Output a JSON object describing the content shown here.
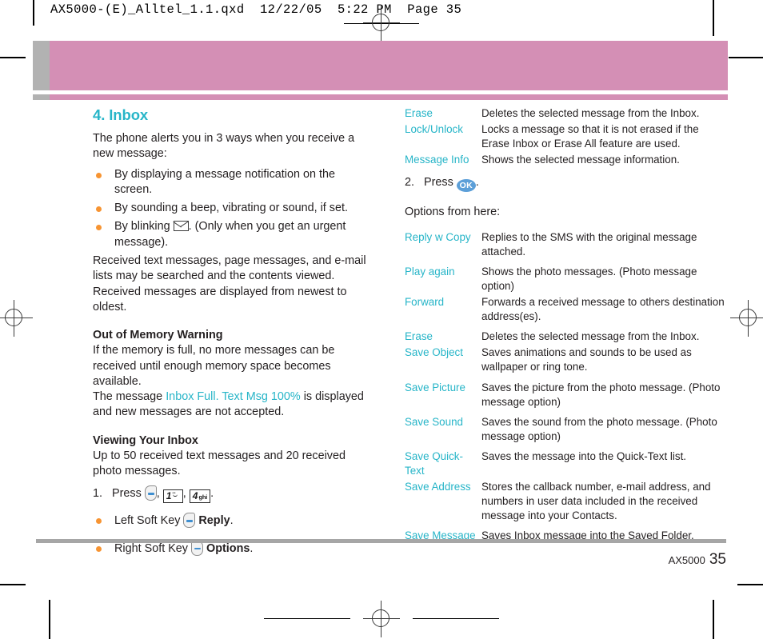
{
  "prepress": {
    "header_line": "AX5000-(E)_Alltel_1.1.qxd  12/22/05  5:22 PM  Page 35"
  },
  "colors": {
    "heading_teal": "#27b5c8",
    "bullet_orange": "#f79432",
    "banner_pink": "#d48fb5",
    "tab_gray": "#b2b2b2",
    "ok_blue": "#5c9fd8",
    "body_text": "#231f20"
  },
  "left_column": {
    "section_title": "4. Inbox",
    "intro": "The phone alerts you in 3 ways when you receive a new message:",
    "alert_bullets": [
      {
        "text_before": "By displaying a message notification on the screen.",
        "icon": null,
        "text_after": ""
      },
      {
        "text_before": "By sounding a beep, vibrating or sound, if set.",
        "icon": null,
        "text_after": ""
      },
      {
        "text_before": "By blinking ",
        "icon": "envelope-icon",
        "text_after": ". (Only when you get an urgent message)."
      }
    ],
    "received_paragraph": "Received text messages, page messages, and e-mail lists may be searched and the contents viewed. Received messages are displayed from newest to oldest.",
    "out_of_memory": {
      "heading": "Out of Memory Warning",
      "line1": "If the memory is full, no more messages can be received until enough memory space becomes available.",
      "line2_before": "The message ",
      "line2_highlight": "Inbox Full. Text Msg 100%",
      "line2_after": " is displayed and new messages are not accepted."
    },
    "viewing_inbox": {
      "heading": "Viewing Your Inbox",
      "capacity": "Up to 50 received text messages and 20 received photo messages.",
      "step_number": "1.",
      "step_label": "Press",
      "keys": [
        {
          "type": "softkey",
          "name": "left-soft-key-icon"
        },
        {
          "type": "numkey",
          "digit": "1",
          "letters": ""
        },
        {
          "type": "numkey",
          "digit": "4",
          "letters": "ghi"
        }
      ],
      "softkey_bullets": [
        {
          "label": "Left Soft Key",
          "icon": "left-soft-key-icon",
          "action": "Reply",
          "suffix": "."
        },
        {
          "label": "Right Soft Key",
          "icon": "right-soft-key-icon",
          "action": "Options",
          "suffix": "."
        }
      ]
    }
  },
  "right_column": {
    "top_options": [
      {
        "term": "Erase",
        "desc": "Deletes the selected message from the Inbox."
      },
      {
        "term": "Lock/Unlock",
        "desc": "Locks a message so that it is not erased if the Erase Inbox or Erase All feature are used."
      },
      {
        "term": "Message Info",
        "desc": "Shows the selected message information."
      }
    ],
    "step_two": {
      "number": "2.",
      "label": "Press",
      "key_icon": "ok-key-icon",
      "key_label": "OK",
      "suffix": "."
    },
    "options_heading": "Options from here:",
    "options": [
      {
        "term": "Reply w Copy",
        "desc": "Replies to the SMS with the original message attached."
      },
      {
        "term": "Play again",
        "desc": "Shows the photo messages. (Photo message option)"
      },
      {
        "term": "Forward",
        "desc": "Forwards a received message to others destination address(es)."
      },
      {
        "term": "Erase",
        "desc": "Deletes the selected message from the Inbox."
      },
      {
        "term": "Save Object",
        "desc": "Saves animations and sounds to be used as wallpaper or ring tone."
      },
      {
        "term": "Save Picture",
        "desc": "Saves the picture from the photo message. (Photo message option)"
      },
      {
        "term": "Save Sound",
        "desc": "Saves the sound from the photo message. (Photo message option)"
      },
      {
        "term": "Save Quick-Text",
        "desc": "Saves the message into the Quick-Text list."
      },
      {
        "term": "Save Address",
        "desc": "Stores the callback number, e-mail address, and numbers in user data included in the received message into your Contacts."
      },
      {
        "term": "Save Message",
        "desc": "Saves Inbox message into the Saved Folder."
      }
    ]
  },
  "footer": {
    "model": "AX5000",
    "page_number": "35"
  }
}
